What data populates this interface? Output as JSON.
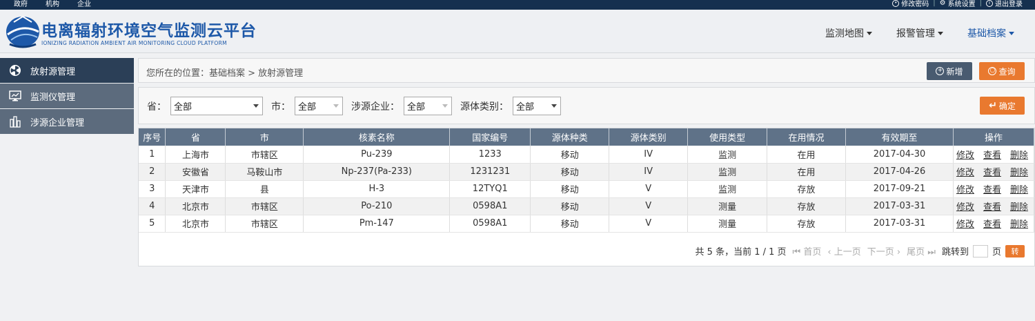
{
  "topbar": {
    "left_links": [
      "政府",
      "机构",
      "企业"
    ],
    "change_password": "修改密码",
    "system_settings": "系统设置",
    "logout": "退出登录"
  },
  "brand": {
    "title": "电离辐射环境空气监测云平台",
    "subtitle": "IONIZING RADIATION AMBIENT AIR MONITORING CLOUD PLATFORM"
  },
  "nav": {
    "items": [
      {
        "label": "监测地图"
      },
      {
        "label": "报警管理"
      },
      {
        "label": "基础档案"
      }
    ]
  },
  "sidebar": {
    "items": [
      {
        "label": "放射源管理"
      },
      {
        "label": "监测仪管理"
      },
      {
        "label": "涉源企业管理"
      }
    ]
  },
  "breadcrumb": "您所在的位置：基础档案 > 放射源管理",
  "actions": {
    "add": "新增",
    "query": "查询",
    "confirm": "确定"
  },
  "filters": {
    "province": {
      "label": "省：",
      "value": "全部"
    },
    "city": {
      "label": "市：",
      "value": "全部"
    },
    "company": {
      "label": "涉源企业：",
      "value": "全部"
    },
    "source_category": {
      "label": "源体类别：",
      "value": "全部"
    }
  },
  "table": {
    "columns": [
      "序号",
      "省",
      "市",
      "核素名称",
      "国家编号",
      "源体种类",
      "源体类别",
      "使用类型",
      "在用情况",
      "有效期至",
      "操作"
    ],
    "op_labels": {
      "edit": "修改",
      "view": "查看",
      "delete": "删除"
    },
    "rows": [
      [
        "1",
        "上海市",
        "市辖区",
        "Pu-239",
        "1233",
        "移动",
        "IV",
        "监测",
        "在用",
        "2017-04-30"
      ],
      [
        "2",
        "安徽省",
        "马鞍山市",
        "Np-237(Pa-233)",
        "1231231",
        "移动",
        "IV",
        "监测",
        "在用",
        "2017-04-26"
      ],
      [
        "3",
        "天津市",
        "县",
        "H-3",
        "12TYQ1",
        "移动",
        "V",
        "监测",
        "存放",
        "2017-09-21"
      ],
      [
        "4",
        "北京市",
        "市辖区",
        "Po-210",
        "0598A1",
        "移动",
        "V",
        "测量",
        "存放",
        "2017-03-31"
      ],
      [
        "5",
        "北京市",
        "市辖区",
        "Pm-147",
        "0598A1",
        "移动",
        "V",
        "测量",
        "存放",
        "2017-03-31"
      ]
    ]
  },
  "pager": {
    "info": "共 5 条，当前 1 / 1 页",
    "first": "首页",
    "prev": "上一页",
    "next": "下一页",
    "last": "尾页",
    "jump_label": "跳转到",
    "page_unit": "页",
    "go": "转"
  },
  "colors": {
    "accent": "#e9792f",
    "primary_dark": "#2b3f57",
    "brand_blue": "#1d58a8"
  }
}
